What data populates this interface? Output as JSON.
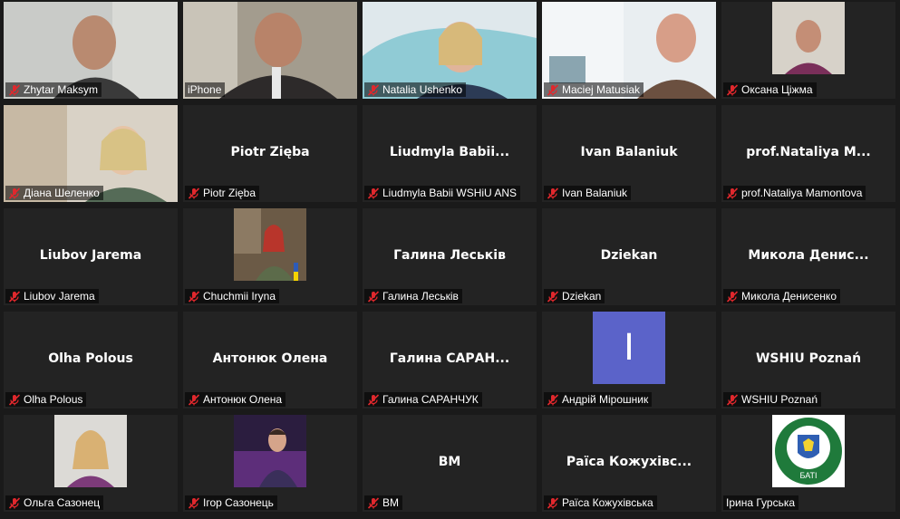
{
  "tiles": [
    {
      "row": 0,
      "col": 0,
      "type": "video",
      "label": "Zhytar Maksym",
      "muted": true
    },
    {
      "row": 0,
      "col": 1,
      "type": "video",
      "label": "iPhone",
      "muted": false
    },
    {
      "row": 0,
      "col": 2,
      "type": "video",
      "label": "Natalia Ushenko",
      "muted": true
    },
    {
      "row": 0,
      "col": 3,
      "type": "video",
      "label": "Maciej Matusiak",
      "muted": true
    },
    {
      "row": 0,
      "col": 4,
      "type": "video",
      "label": "Оксана Ціжма",
      "muted": true
    },
    {
      "row": 1,
      "col": 0,
      "type": "video",
      "label": "Діана Шеленко",
      "muted": true
    },
    {
      "row": 1,
      "col": 1,
      "type": "name",
      "center": "Piotr Zięba",
      "label": "Piotr Zięba",
      "muted": true
    },
    {
      "row": 1,
      "col": 2,
      "type": "name",
      "center": "Liudmyla  Babii...",
      "label": "Liudmyla Babii WSHiU ANS",
      "muted": true
    },
    {
      "row": 1,
      "col": 3,
      "type": "name",
      "center": "Ivan Balaniuk",
      "label": "Ivan Balaniuk",
      "muted": true
    },
    {
      "row": 1,
      "col": 4,
      "type": "name",
      "center": "prof.Nataliya  M...",
      "label": "prof.Nataliya Mamontova",
      "muted": true
    },
    {
      "row": 2,
      "col": 0,
      "type": "name",
      "center": "Liubov Jarema",
      "label": "Liubov Jarema",
      "muted": true
    },
    {
      "row": 2,
      "col": 1,
      "type": "avatar",
      "label": "Chuchmii Iryna",
      "muted": true
    },
    {
      "row": 2,
      "col": 2,
      "type": "name",
      "center": "Галина Леськів",
      "label": "Галина Леськів",
      "muted": true
    },
    {
      "row": 2,
      "col": 3,
      "type": "name",
      "center": "Dziekan",
      "label": "Dziekan",
      "muted": true
    },
    {
      "row": 2,
      "col": 4,
      "type": "name",
      "center": "Микола  Денис...",
      "label": "Микола Денисенко",
      "muted": true
    },
    {
      "row": 3,
      "col": 0,
      "type": "name",
      "center": "Olha Polous",
      "label": "Olha Polous",
      "muted": true
    },
    {
      "row": 3,
      "col": 1,
      "type": "name",
      "center": "Антонюк Олена",
      "label": "Антонюк Олена",
      "muted": true
    },
    {
      "row": 3,
      "col": 2,
      "type": "name",
      "center": "Галина  САРАН...",
      "label": "Галина САРАНЧУК",
      "muted": true
    },
    {
      "row": 3,
      "col": 3,
      "type": "initial",
      "initial": "I",
      "label": "Андрій Мірошник",
      "muted": true
    },
    {
      "row": 3,
      "col": 4,
      "type": "name",
      "center": "WSHIU Poznań",
      "label": "WSHIU Poznań",
      "muted": true
    },
    {
      "row": 4,
      "col": 0,
      "type": "avatar",
      "label": "Ольга Сазонец",
      "muted": true
    },
    {
      "row": 4,
      "col": 1,
      "type": "avatar",
      "label": "Ігор Сазонець",
      "muted": true
    },
    {
      "row": 4,
      "col": 2,
      "type": "name",
      "center": "BM",
      "label": "BM",
      "muted": true
    },
    {
      "row": 4,
      "col": 3,
      "type": "name",
      "center": "Раїса  Кожухівс...",
      "label": "Раїса Кожухівська",
      "muted": true
    },
    {
      "row": 4,
      "col": 4,
      "type": "logo",
      "logo_text": "БАТІ",
      "label": "Ірина Гурська",
      "muted": false
    }
  ],
  "colors": {
    "tile_bg": "#232323",
    "gap_bg": "#1a1a1a",
    "mute_red": "#e0282d",
    "initial_bg": "#5b63c9"
  }
}
